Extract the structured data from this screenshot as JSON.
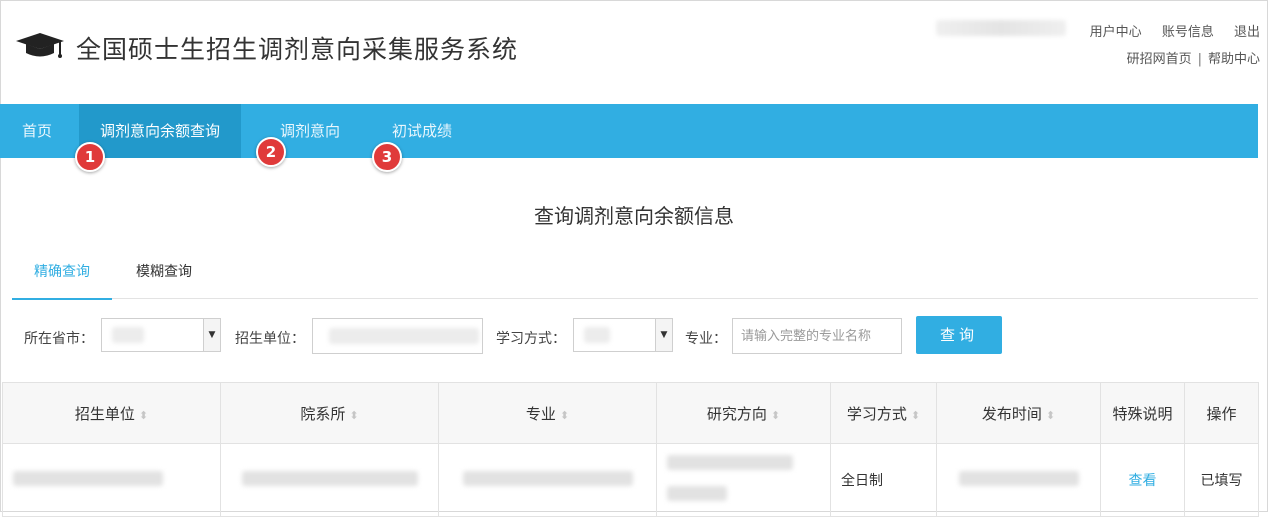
{
  "header": {
    "title": "全国硕士生招生调剂意向采集服务系统",
    "links_row1": [
      "用户中心",
      "账号信息",
      "退出"
    ],
    "links_row2": [
      "研招网首页",
      "帮助中心"
    ],
    "links_row2_separator": "|"
  },
  "nav": {
    "items": [
      {
        "label": "首页",
        "active": false
      },
      {
        "label": "调剂意向余额查询",
        "active": true
      },
      {
        "label": "调剂意向",
        "active": false
      },
      {
        "label": "初试成绩",
        "active": false
      }
    ],
    "badges": [
      "1",
      "2",
      "3"
    ]
  },
  "page": {
    "title": "查询调剂意向余额信息"
  },
  "tabs": [
    {
      "label": "精确查询",
      "active": true
    },
    {
      "label": "模糊查询",
      "active": false
    }
  ],
  "filters": {
    "province_label": "所在省市：",
    "unit_label": "招生单位：",
    "mode_label": "学习方式：",
    "major_label": "专业：",
    "major_placeholder": "请输入完整的专业名称",
    "query_button": "查询"
  },
  "table": {
    "headers": [
      "招生单位",
      "院系所",
      "专业",
      "研究方向",
      "学习方式",
      "发布时间",
      "特殊说明",
      "操作"
    ],
    "sort_icon": "sort-arrows-icon",
    "row": {
      "mode": "全日制",
      "note_link": "查看",
      "action": "已填写"
    }
  },
  "colors": {
    "nav_bg": "#31aee2",
    "nav_active_bg": "#2299cb",
    "accent": "#31aee2",
    "badge": "#e03a3a"
  }
}
